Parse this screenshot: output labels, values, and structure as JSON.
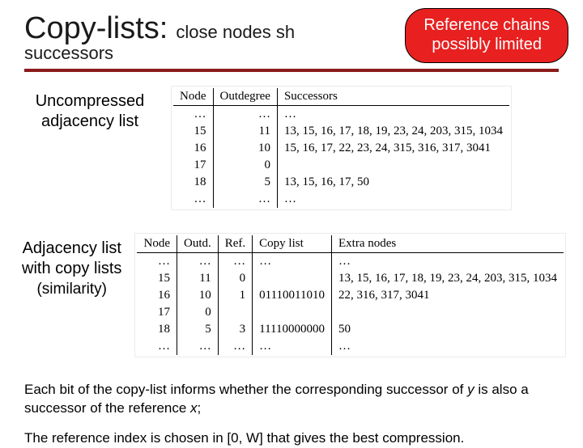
{
  "header": {
    "title_big": "Copy-lists:",
    "title_small": "close nodes sh",
    "subtitle": "successors"
  },
  "callout": {
    "line1": "Reference chains",
    "line2": "possibly limited"
  },
  "section1": {
    "label": "Uncompressed adjacency list",
    "headers": [
      "Node",
      "Outdegree",
      "Successors"
    ],
    "rows": [
      {
        "node": "…",
        "out": "…",
        "succ": "…"
      },
      {
        "node": "15",
        "out": "11",
        "succ": "13, 15, 16, 17, 18, 19, 23, 24, 203, 315, 1034"
      },
      {
        "node": "16",
        "out": "10",
        "succ": "15, 16, 17, 22, 23, 24, 315, 316, 317, 3041"
      },
      {
        "node": "17",
        "out": "0",
        "succ": ""
      },
      {
        "node": "18",
        "out": "5",
        "succ": "13, 15, 16, 17, 50"
      },
      {
        "node": "…",
        "out": "…",
        "succ": "…"
      }
    ]
  },
  "section2": {
    "label": "Adjacency list with copy lists",
    "paren": "(similarity)",
    "headers": [
      "Node",
      "Outd.",
      "Ref.",
      "Copy list",
      "Extra nodes"
    ],
    "rows": [
      {
        "node": "…",
        "out": "…",
        "ref": "…",
        "copy": "…",
        "extra": "…"
      },
      {
        "node": "15",
        "out": "11",
        "ref": "0",
        "copy": "",
        "extra": "13, 15, 16, 17, 18, 19, 23, 24, 203, 315, 1034"
      },
      {
        "node": "16",
        "out": "10",
        "ref": "1",
        "copy": "01110011010",
        "extra": "22, 316, 317, 3041"
      },
      {
        "node": "17",
        "out": "0",
        "ref": "",
        "copy": "",
        "extra": ""
      },
      {
        "node": "18",
        "out": "5",
        "ref": "3",
        "copy": "11110000000",
        "extra": "50"
      },
      {
        "node": "…",
        "out": "…",
        "ref": "…",
        "copy": "…",
        "extra": "…"
      }
    ]
  },
  "body_text": {
    "p1_a": "Each bit of the copy-list informs whether the corresponding successor of ",
    "p1_y": "y",
    "p1_b": " is also a successor of the reference ",
    "p1_x": "x",
    "p1_c": ";",
    "p2": "The reference index is chosen in [0, W] that gives the best compression."
  }
}
